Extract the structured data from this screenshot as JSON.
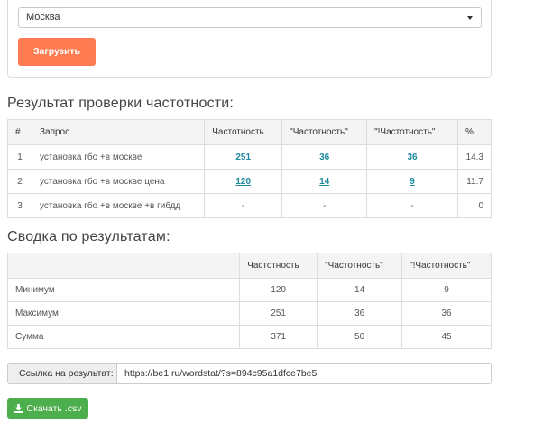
{
  "form": {
    "region_value": "Москва",
    "load_button": "Загрузить"
  },
  "results": {
    "title": "Результат проверки частотности:",
    "headers": [
      "#",
      "Запрос",
      "Частотность",
      "\"Частотность\"",
      "\"!Частотность\"",
      "%"
    ],
    "rows": [
      {
        "n": "1",
        "query": "установка гбо +в москве",
        "freq": "251",
        "freq_quoted": "36",
        "freq_exact": "36",
        "percent": "14.3"
      },
      {
        "n": "2",
        "query": "установка гбо +в москве цена",
        "freq": "120",
        "freq_quoted": "14",
        "freq_exact": "9",
        "percent": "11.7"
      },
      {
        "n": "3",
        "query": "установка гбо +в москве +в гибдд",
        "freq": "-",
        "freq_quoted": "-",
        "freq_exact": "-",
        "percent": "0"
      }
    ]
  },
  "summary": {
    "title": "Сводка по результатам:",
    "headers": [
      "",
      "Частотность",
      "\"Частотность\"",
      "\"!Частотность\""
    ],
    "rows": [
      {
        "label": "Минимум",
        "freq": "120",
        "freq_quoted": "14",
        "freq_exact": "9"
      },
      {
        "label": "Максимум",
        "freq": "251",
        "freq_quoted": "36",
        "freq_exact": "36"
      },
      {
        "label": "Сумма",
        "freq": "371",
        "freq_quoted": "50",
        "freq_exact": "45"
      }
    ]
  },
  "share": {
    "label": "Ссылка на результат:",
    "url": "https://be1.ru/wordstat/?s=894c95a1dfce7be5"
  },
  "download": {
    "label": "Скачать .csv",
    "icon": "download-icon"
  },
  "colors": {
    "accent_orange": "#ff7b52",
    "link_teal": "#1a8a9c",
    "download_green": "#4cae4c"
  }
}
